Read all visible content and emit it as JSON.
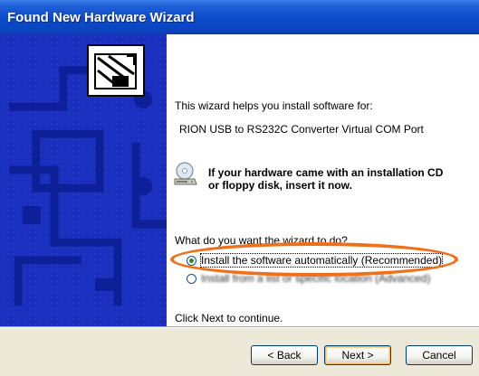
{
  "window": {
    "title": "Found New Hardware Wizard"
  },
  "content": {
    "intro": "This wizard helps you install software for:",
    "device": "RION USB to RS232C Converter Virtual COM Port",
    "cd_line1": "If your hardware came with an installation CD",
    "cd_line2": "or floppy disk, insert it now.",
    "question": "What do you want the wizard to do?",
    "options": [
      {
        "label": "Install the software automatically (Recommended)",
        "selected": true
      },
      {
        "label": "Install from a list or specific location (Advanced)",
        "selected": false
      }
    ],
    "continue_text": "Click Next to continue."
  },
  "buttons": {
    "back": "< Back",
    "next": "Next >",
    "cancel": "Cancel"
  },
  "colors": {
    "annotation_ellipse": "#f07019",
    "side_panel": "#1a2fbd",
    "title_bar": "#0a46c0"
  },
  "icons": {
    "hardware": "hardware-card-icon",
    "cd": "cd-drive-icon"
  }
}
